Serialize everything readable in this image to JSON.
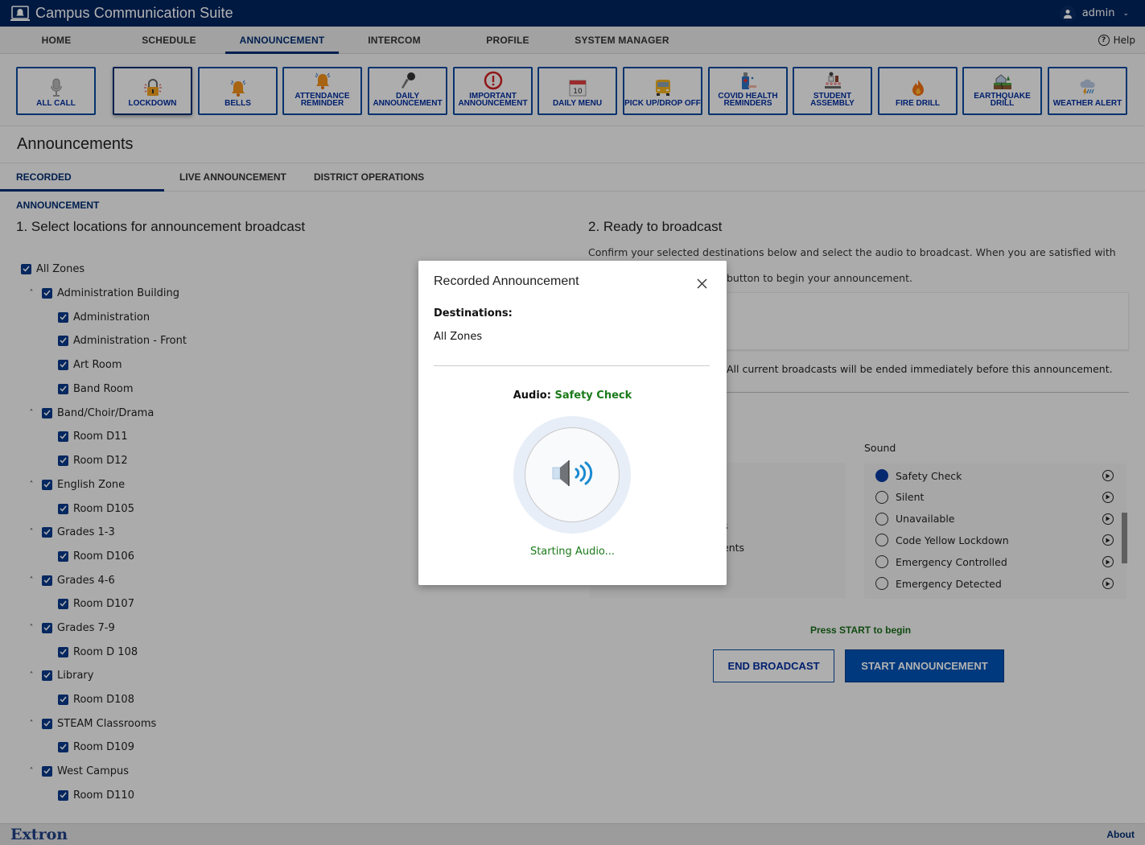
{
  "header": {
    "title": "Campus Communication Suite",
    "logo_icon": "bell-screen-icon",
    "user": "admin",
    "user_icon": "user-icon"
  },
  "nav": {
    "items": [
      {
        "label": "HOME",
        "active": false
      },
      {
        "label": "SCHEDULE",
        "active": false
      },
      {
        "label": "ANNOUNCEMENT",
        "active": true
      },
      {
        "label": "INTERCOM",
        "active": false
      },
      {
        "label": "PROFILE",
        "active": false
      },
      {
        "label": "SYSTEM MANAGER",
        "active": false
      }
    ],
    "help_label": "Help"
  },
  "quick_buttons": [
    {
      "label": "ALL CALL",
      "icon": "microphone-icon"
    },
    {
      "label": "LOCKDOWN",
      "icon": "padlock-icon",
      "active": true
    },
    {
      "label": "BELLS",
      "icon": "bell-icon"
    },
    {
      "label": "ATTENDANCE REMINDER",
      "icon": "bell-icon"
    },
    {
      "label": "DAILY ANNOUNCEMENT",
      "icon": "handheld-mic-icon"
    },
    {
      "label": "IMPORTANT ANNOUNCEMENT",
      "icon": "exclamation-icon"
    },
    {
      "label": "DAILY MENU",
      "icon": "calendar-icon",
      "calendar_day": "10"
    },
    {
      "label": "PICK UP/DROP OFF",
      "icon": "school-bus-icon"
    },
    {
      "label": "COVID HEALTH REMINDERS",
      "icon": "hand-sanitizer-icon"
    },
    {
      "label": "STUDENT ASSEMBLY",
      "icon": "assembly-icon"
    },
    {
      "label": "FIRE DRILL",
      "icon": "fire-icon"
    },
    {
      "label": "EARTHQUAKE DRILL",
      "icon": "earthquake-icon"
    },
    {
      "label": "WEATHER ALERT",
      "icon": "storm-cloud-icon"
    }
  ],
  "page": {
    "title": "Announcements",
    "tabs": [
      {
        "label": "RECORDED ANNOUNCEMENT",
        "active": true
      },
      {
        "label": "LIVE ANNOUNCEMENT",
        "active": false
      },
      {
        "label": "DISTRICT OPERATIONS",
        "active": false
      }
    ]
  },
  "locations": {
    "heading": "1. Select locations for announcement broadcast",
    "tree": [
      {
        "label": "All Zones",
        "level": 0,
        "checked": true
      },
      {
        "label": "Administration Building",
        "level": 1,
        "checked": true,
        "expanded": true
      },
      {
        "label": "Administration",
        "level": 2,
        "checked": true
      },
      {
        "label": "Administration - Front",
        "level": 2,
        "checked": true
      },
      {
        "label": "Art Room",
        "level": 2,
        "checked": true
      },
      {
        "label": "Band Room",
        "level": 2,
        "checked": true
      },
      {
        "label": "Band/Choir/Drama",
        "level": 1,
        "checked": true,
        "expanded": true
      },
      {
        "label": "Room D11",
        "level": 2,
        "checked": true
      },
      {
        "label": "Room D12",
        "level": 2,
        "checked": true
      },
      {
        "label": "English Zone",
        "level": 1,
        "checked": true,
        "expanded": true
      },
      {
        "label": "Room D105",
        "level": 2,
        "checked": true
      },
      {
        "label": "Grades 1-3",
        "level": 1,
        "checked": true,
        "expanded": true
      },
      {
        "label": "Room D106",
        "level": 2,
        "checked": true
      },
      {
        "label": "Grades 4-6",
        "level": 1,
        "checked": true,
        "expanded": true
      },
      {
        "label": "Room D107",
        "level": 2,
        "checked": true
      },
      {
        "label": "Grades 7-9",
        "level": 1,
        "checked": true,
        "expanded": true
      },
      {
        "label": "Room D 108",
        "level": 2,
        "checked": true
      },
      {
        "label": "Library",
        "level": 1,
        "checked": true,
        "expanded": true
      },
      {
        "label": "Room D108",
        "level": 2,
        "checked": true
      },
      {
        "label": "STEAM Classrooms",
        "level": 1,
        "checked": true,
        "expanded": true
      },
      {
        "label": "Room D109",
        "level": 2,
        "checked": true
      },
      {
        "label": "West Campus",
        "level": 1,
        "checked": true,
        "expanded": true
      },
      {
        "label": "Room D110",
        "level": 2,
        "checked": true
      }
    ]
  },
  "broadcast": {
    "heading": "2. Ready to broadcast",
    "instructions_line1": "Confirm your selected destinations below and select the audio to broadcast. When you are satisfied with your selections,",
    "instructions_line2": "button to begin your announcement.",
    "warning": "All current broadcasts will be ended immediately before this announcement.",
    "partial_list_text_1": "s",
    "partial_list_text_2": "ents",
    "sound_label": "Sound",
    "sounds": [
      {
        "label": "Safety Check",
        "selected": true
      },
      {
        "label": "Silent",
        "selected": false
      },
      {
        "label": "Unavailable",
        "selected": false
      },
      {
        "label": "Code Yellow Lockdown",
        "selected": false
      },
      {
        "label": "Emergency Controlled",
        "selected": false
      },
      {
        "label": "Emergency Detected",
        "selected": false
      }
    ],
    "press_start": "Press START to begin",
    "end_button": "END BROADCAST",
    "start_button": "START ANNOUNCEMENT"
  },
  "footer": {
    "brand": "Extron",
    "about": "About"
  },
  "modal": {
    "title": "Recorded Announcement",
    "destinations_label": "Destinations:",
    "destinations_value": "All Zones",
    "audio_label": "Audio:",
    "audio_name": "Safety Check",
    "status": "Starting Audio..."
  },
  "colors": {
    "brand_navy": "#00245e",
    "accent_blue": "#0052b4",
    "status_green": "#1a7a1a"
  }
}
